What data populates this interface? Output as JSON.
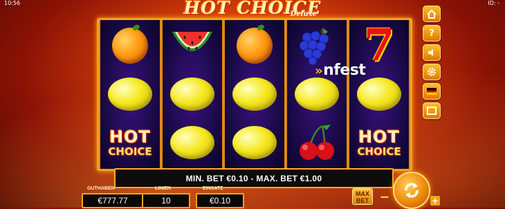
{
  "status": {
    "time": "10:56",
    "id": "ID: -"
  },
  "logo": {
    "main": "HOT CHOICE",
    "sub": "Deluxe"
  },
  "watermark": "nfest",
  "reels": [
    [
      "orange",
      "lemon",
      "hot-choice"
    ],
    [
      "watermelon",
      "lemon",
      "lemon"
    ],
    [
      "orange",
      "lemon",
      "lemon"
    ],
    [
      "grapes",
      "lemon",
      "cherries"
    ],
    [
      "seven",
      "lemon",
      "hot-choice"
    ]
  ],
  "hot_choice": {
    "line1": "HOT",
    "line2": "CHOICE"
  },
  "seven": "7",
  "info_bar": "MIN. BET €0.10 - MAX. BET €1.00",
  "meters": {
    "balance": {
      "label": "GUTHABEN",
      "value": "€777.77"
    },
    "lines": {
      "label": "LINIEN",
      "value": "10"
    },
    "stake": {
      "label": "EINSATZ",
      "value": "€0.10"
    }
  },
  "max_bet": {
    "line1": "MAX",
    "line2": "BET"
  },
  "sidebar": [
    "home-icon",
    "help-icon",
    "sound-icon",
    "settings-icon",
    "german-flag-icon",
    "fullscreen-icon"
  ],
  "colors": {
    "frame": "#f2a41a",
    "reel_bg": "#1b0a4a",
    "background": "#c8380a"
  }
}
